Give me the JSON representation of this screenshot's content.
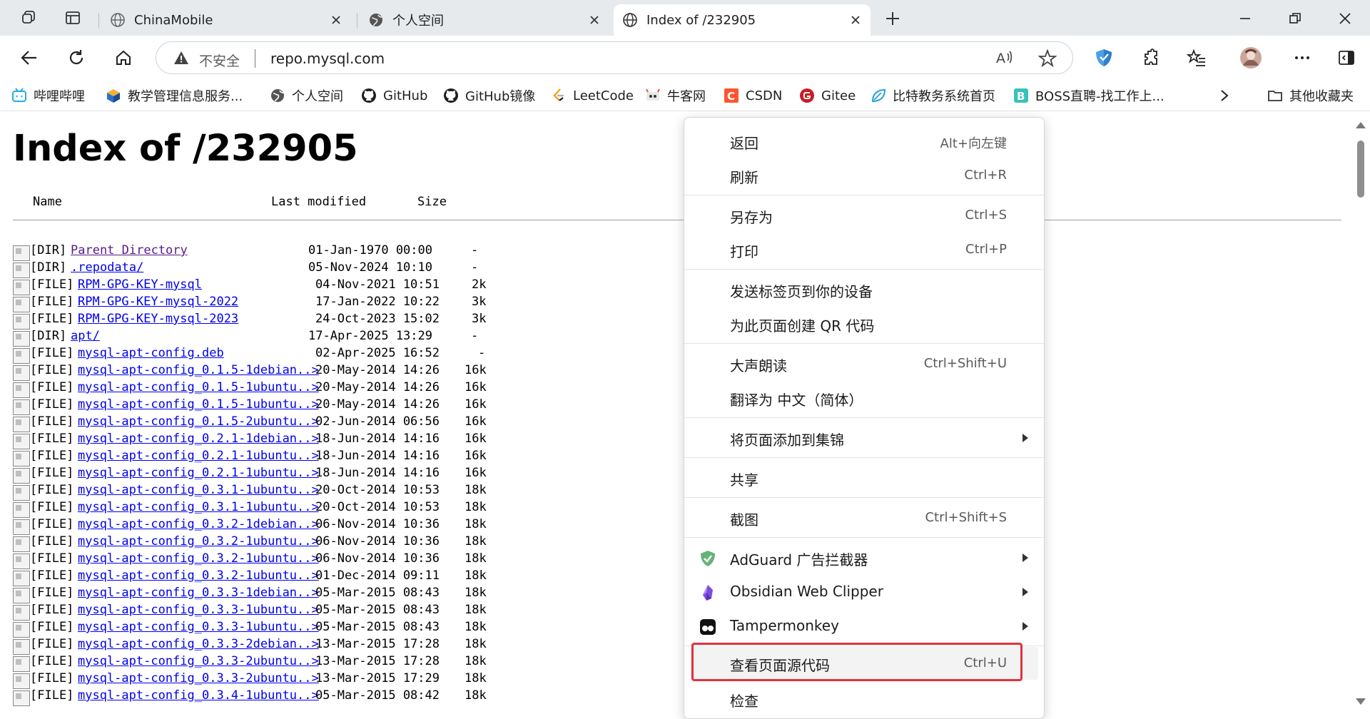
{
  "browser": {
    "tabs": [
      {
        "title": "ChinaMobile",
        "favicon": "globe-icon"
      },
      {
        "title": "个人空间",
        "favicon": "globe-icon"
      },
      {
        "title": "Index of /232905",
        "favicon": "globe-icon",
        "active": true
      }
    ],
    "address": {
      "security_label": "不安全",
      "url": "repo.mysql.com",
      "read_aloud": "Aʹ"
    },
    "bookmarks": [
      {
        "label": "哔哩哔哩",
        "icon": "bilibili-icon"
      },
      {
        "label": "教学管理信息服务...",
        "icon": "cube-icon"
      },
      {
        "label": "个人空间",
        "icon": "globe-icon"
      },
      {
        "label": "GitHub",
        "icon": "github-icon"
      },
      {
        "label": "GitHub镜像",
        "icon": "github-icon"
      },
      {
        "label": "LeetCode",
        "icon": "leetcode-icon"
      },
      {
        "label": "牛客网",
        "icon": "nowcoder-icon"
      },
      {
        "label": "CSDN",
        "icon": "csdn-icon"
      },
      {
        "label": "Gitee",
        "icon": "gitee-icon"
      },
      {
        "label": "比特教务系统首页",
        "icon": "leaf-icon"
      },
      {
        "label": "BOSS直聘-找工作上...",
        "icon": "boss-icon"
      }
    ],
    "other_bookmarks": "其他收藏夹"
  },
  "page": {
    "title": "Index of /232905",
    "columns": {
      "name": "Name",
      "modified": "Last modified",
      "size": "Size"
    },
    "entries": [
      {
        "kind": "[DIR]",
        "name": "Parent Directory",
        "date": "01-Jan-1970 00:00",
        "size": "-",
        "visited": true
      },
      {
        "kind": "[DIR]",
        "name": ".repodata/",
        "date": "05-Nov-2024 10:10",
        "size": "-"
      },
      {
        "kind": "[FILE]",
        "name": "RPM-GPG-KEY-mysql",
        "date": "04-Nov-2021 10:51",
        "size": "2k"
      },
      {
        "kind": "[FILE]",
        "name": "RPM-GPG-KEY-mysql-2022",
        "date": "17-Jan-2022 10:22",
        "size": "3k"
      },
      {
        "kind": "[FILE]",
        "name": "RPM-GPG-KEY-mysql-2023",
        "date": "24-Oct-2023 15:02",
        "size": "3k"
      },
      {
        "kind": "[DIR]",
        "name": "apt/",
        "date": "17-Apr-2025 13:29",
        "size": "-"
      },
      {
        "kind": "[FILE]",
        "name": "mysql-apt-config.deb",
        "date": "02-Apr-2025 16:52",
        "size": "-"
      },
      {
        "kind": "[FILE]",
        "name": "mysql-apt-config_0.1.5-1debian..>",
        "date": "20-May-2014 14:26",
        "size": "16k"
      },
      {
        "kind": "[FILE]",
        "name": "mysql-apt-config_0.1.5-1ubuntu..>",
        "date": "20-May-2014 14:26",
        "size": "16k"
      },
      {
        "kind": "[FILE]",
        "name": "mysql-apt-config_0.1.5-1ubuntu..>",
        "date": "20-May-2014 14:26",
        "size": "16k"
      },
      {
        "kind": "[FILE]",
        "name": "mysql-apt-config_0.1.5-2ubuntu..>",
        "date": "02-Jun-2014 06:56",
        "size": "16k"
      },
      {
        "kind": "[FILE]",
        "name": "mysql-apt-config_0.2.1-1debian..>",
        "date": "18-Jun-2014 14:16",
        "size": "16k"
      },
      {
        "kind": "[FILE]",
        "name": "mysql-apt-config_0.2.1-1ubuntu..>",
        "date": "18-Jun-2014 14:16",
        "size": "16k"
      },
      {
        "kind": "[FILE]",
        "name": "mysql-apt-config_0.2.1-1ubuntu..>",
        "date": "18-Jun-2014 14:16",
        "size": "16k"
      },
      {
        "kind": "[FILE]",
        "name": "mysql-apt-config_0.3.1-1ubuntu..>",
        "date": "20-Oct-2014 10:53",
        "size": "18k"
      },
      {
        "kind": "[FILE]",
        "name": "mysql-apt-config_0.3.1-1ubuntu..>",
        "date": "20-Oct-2014 10:53",
        "size": "18k"
      },
      {
        "kind": "[FILE]",
        "name": "mysql-apt-config_0.3.2-1debian..>",
        "date": "06-Nov-2014 10:36",
        "size": "18k"
      },
      {
        "kind": "[FILE]",
        "name": "mysql-apt-config_0.3.2-1ubuntu..>",
        "date": "06-Nov-2014 10:36",
        "size": "18k"
      },
      {
        "kind": "[FILE]",
        "name": "mysql-apt-config_0.3.2-1ubuntu..>",
        "date": "06-Nov-2014 10:36",
        "size": "18k"
      },
      {
        "kind": "[FILE]",
        "name": "mysql-apt-config_0.3.2-1ubuntu..>",
        "date": "01-Dec-2014 09:11",
        "size": "18k"
      },
      {
        "kind": "[FILE]",
        "name": "mysql-apt-config_0.3.3-1debian..>",
        "date": "05-Mar-2015 08:43",
        "size": "18k"
      },
      {
        "kind": "[FILE]",
        "name": "mysql-apt-config_0.3.3-1ubuntu..>",
        "date": "05-Mar-2015 08:43",
        "size": "18k"
      },
      {
        "kind": "[FILE]",
        "name": "mysql-apt-config_0.3.3-1ubuntu..>",
        "date": "05-Mar-2015 08:43",
        "size": "18k"
      },
      {
        "kind": "[FILE]",
        "name": "mysql-apt-config_0.3.3-2debian..>",
        "date": "13-Mar-2015 17:28",
        "size": "18k"
      },
      {
        "kind": "[FILE]",
        "name": "mysql-apt-config_0.3.3-2ubuntu..>",
        "date": "13-Mar-2015 17:28",
        "size": "18k"
      },
      {
        "kind": "[FILE]",
        "name": "mysql-apt-config_0.3.3-2ubuntu..>",
        "date": "13-Mar-2015 17:29",
        "size": "18k"
      },
      {
        "kind": "[FILE]",
        "name": "mysql-apt-config_0.3.4-1ubuntu..>",
        "date": "05-Mar-2015 08:42",
        "size": "18k"
      }
    ]
  },
  "context_menu": {
    "items": [
      {
        "label": "返回",
        "shortcut": "Alt+向左键"
      },
      {
        "label": "刷新",
        "shortcut": "Ctrl+R"
      },
      {
        "label": "另存为",
        "shortcut": "Ctrl+S"
      },
      {
        "label": "打印",
        "shortcut": "Ctrl+P"
      },
      {
        "label": "发送标签页到你的设备",
        "shortcut": ""
      },
      {
        "label": "为此页面创建 QR 代码",
        "shortcut": ""
      },
      {
        "label": "大声朗读",
        "shortcut": "Ctrl+Shift+U"
      },
      {
        "label": "翻译为 中文（简体）",
        "shortcut": ""
      },
      {
        "label": "将页面添加到集锦",
        "shortcut": "",
        "submenu": true
      },
      {
        "label": "共享",
        "shortcut": ""
      },
      {
        "label": "截图",
        "shortcut": "Ctrl+Shift+S"
      },
      {
        "label": "AdGuard 广告拦截器",
        "shortcut": "",
        "submenu": true,
        "icon": "adguard-icon"
      },
      {
        "label": "Obsidian Web Clipper",
        "shortcut": "",
        "submenu": true,
        "icon": "obsidian-icon"
      },
      {
        "label": "Tampermonkey",
        "shortcut": "",
        "submenu": true,
        "icon": "tampermonkey-icon"
      },
      {
        "label": "查看页面源代码",
        "shortcut": "Ctrl+U",
        "highlighted": true
      },
      {
        "label": "检查",
        "shortcut": ""
      }
    ]
  },
  "colors": {
    "link": "#0000ee",
    "visited_link": "#551a8b",
    "highlight_box": "#e0323d",
    "tabstrip_bg": "#e7eaed"
  }
}
